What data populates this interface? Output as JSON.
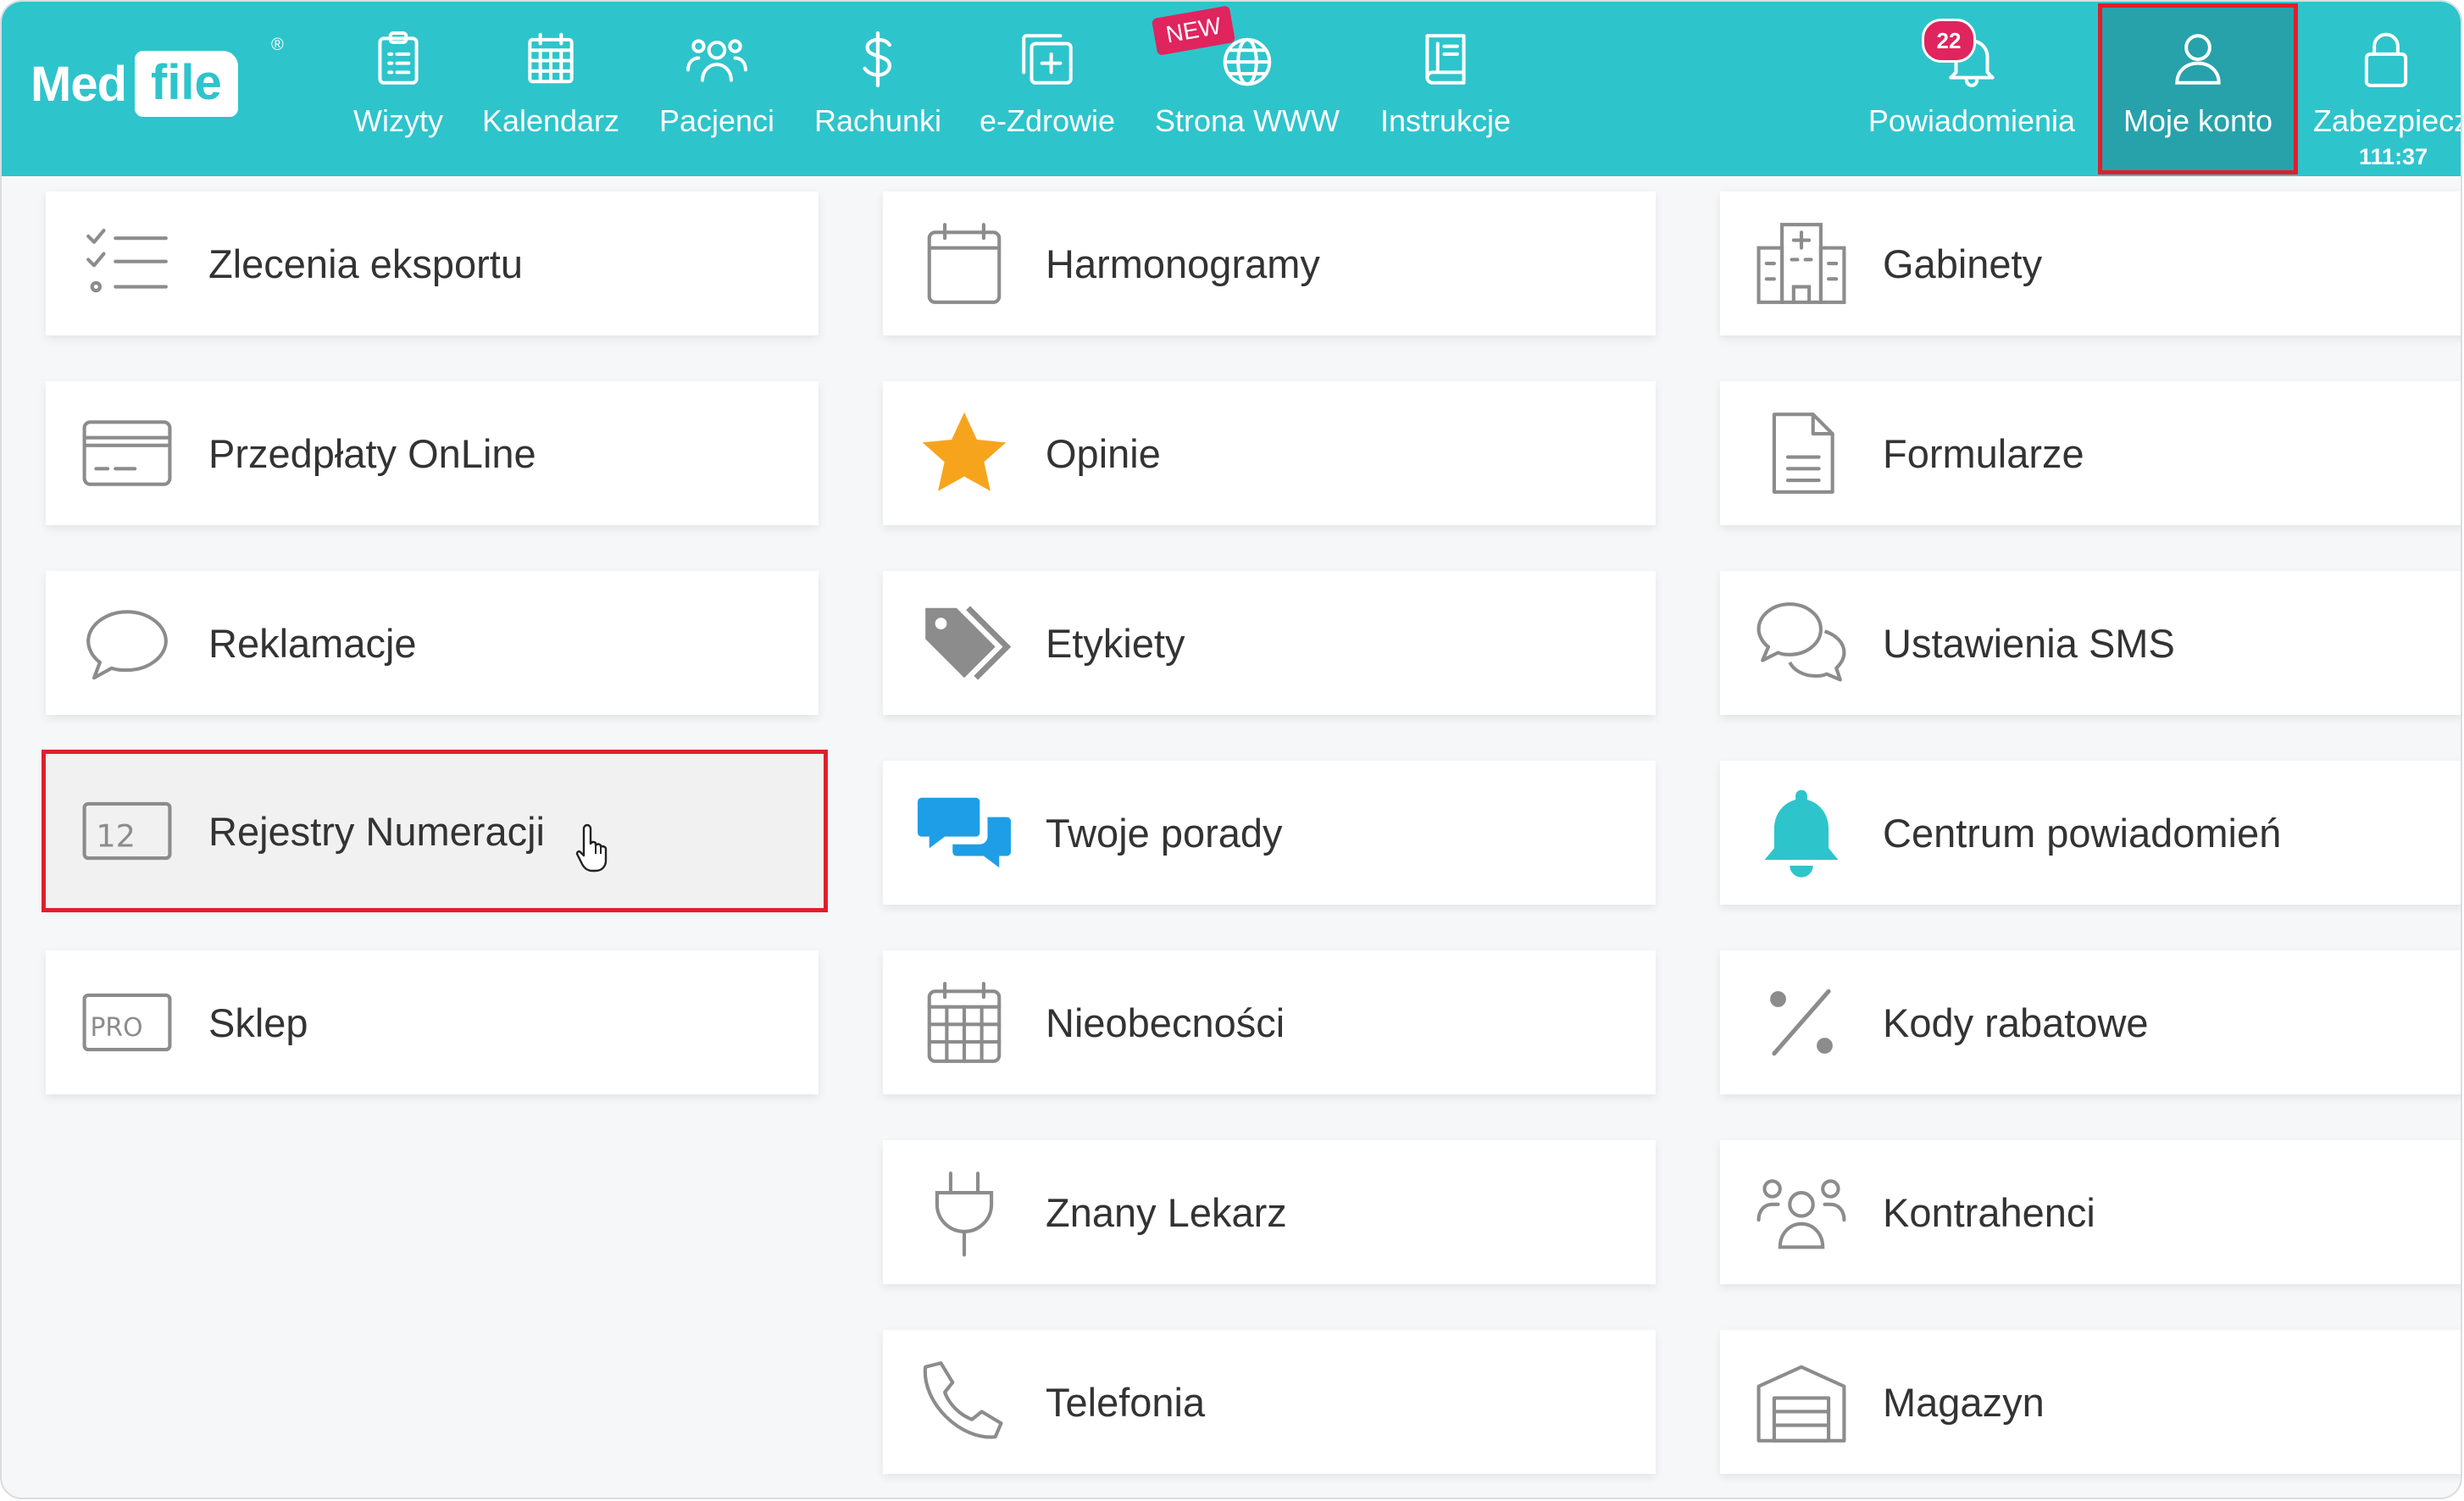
{
  "app": {
    "logo_part1": "Med",
    "logo_part2": "file",
    "logo_mark": "®"
  },
  "colors": {
    "accent": "#2ec4cc",
    "active": "#27a2aa",
    "badge": "#e0245e",
    "highlight": "#e01e2d",
    "star": "#f7a41d",
    "blue": "#1e9ee6",
    "bell": "#2ec4cc"
  },
  "nav": {
    "items": [
      {
        "label": "Wizyty",
        "icon": "clipboard-icon"
      },
      {
        "label": "Kalendarz",
        "icon": "calendar-icon"
      },
      {
        "label": "Pacjenci",
        "icon": "users-icon"
      },
      {
        "label": "Rachunki",
        "icon": "dollar-icon"
      },
      {
        "label": "e-Zdrowie",
        "icon": "medical-cross-icon"
      },
      {
        "label": "Strona WWW",
        "icon": "globe-icon"
      },
      {
        "label": "Instrukcje",
        "icon": "book-icon"
      }
    ],
    "new_badge": "NEW",
    "notifications": {
      "label": "Powiadomienia",
      "count": "22",
      "icon": "bell-icon"
    },
    "account": {
      "label": "Moje konto",
      "icon": "user-icon"
    },
    "security": {
      "label": "Zabezpiecz",
      "timer": "111:37",
      "icon": "lock-icon"
    }
  },
  "tiles": {
    "col1": [
      {
        "label": "Zlecenia eksportu",
        "icon": "checklist-icon"
      },
      {
        "label": "Przedpłaty OnLine",
        "icon": "credit-card-icon"
      },
      {
        "label": "Reklamacje",
        "icon": "speech-bubble-icon"
      },
      {
        "label": "Rejestry Numeracji",
        "icon": "number-register-icon",
        "icon_text": "12"
      },
      {
        "label": "Sklep",
        "icon": "pro-badge-icon",
        "icon_text": "PRO"
      }
    ],
    "col2": [
      {
        "label": "Harmonogramy",
        "icon": "calendar-blank-icon"
      },
      {
        "label": "Opinie",
        "icon": "star-icon"
      },
      {
        "label": "Etykiety",
        "icon": "tags-icon"
      },
      {
        "label": "Twoje porady",
        "icon": "chat-bubbles-icon"
      },
      {
        "label": "Nieobecności",
        "icon": "calendar-grid-icon"
      },
      {
        "label": "Znany Lekarz",
        "icon": "plug-icon"
      },
      {
        "label": "Telefonia",
        "icon": "phone-icon"
      }
    ],
    "col3": [
      {
        "label": "Gabinety",
        "icon": "hospital-icon"
      },
      {
        "label": "Formularze",
        "icon": "document-icon"
      },
      {
        "label": "Ustawienia SMS",
        "icon": "sms-bubbles-icon"
      },
      {
        "label": "Centrum powiadomień",
        "icon": "bell-filled-icon"
      },
      {
        "label": "Kody rabatowe",
        "icon": "percent-icon"
      },
      {
        "label": "Kontrahenci",
        "icon": "group-icon"
      },
      {
        "label": "Magazyn",
        "icon": "warehouse-icon"
      }
    ]
  }
}
